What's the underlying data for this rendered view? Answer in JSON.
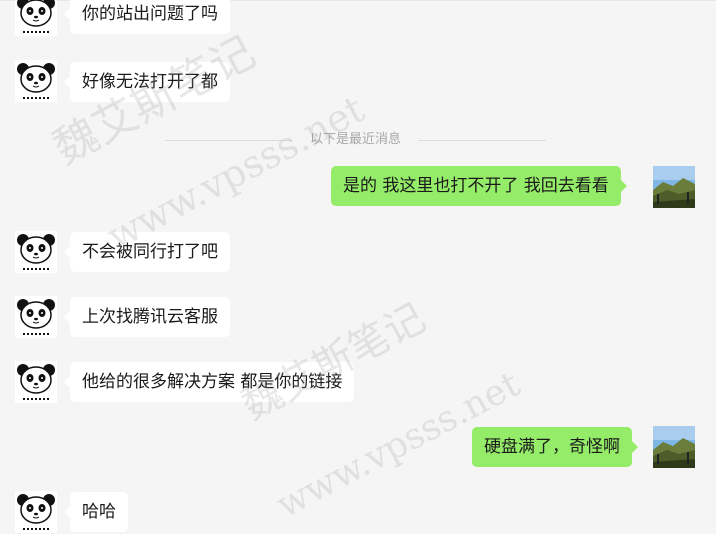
{
  "chat": {
    "divider_text": "以下是最近消息",
    "messages": [
      {
        "side": "in",
        "text": "你的站出问题了吗"
      },
      {
        "side": "in",
        "text": "好像无法打开了都"
      },
      {
        "side": "out",
        "text": "是的 我这里也打不开了 我回去看看"
      },
      {
        "side": "in",
        "text": "不会被同行打了吧"
      },
      {
        "side": "in",
        "text": "上次找腾讯云客服"
      },
      {
        "side": "in",
        "text": "他给的很多解决方案 都是你的链接"
      },
      {
        "side": "out",
        "text": "硬盘满了，奇怪啊"
      },
      {
        "side": "in",
        "text": "哈哈"
      }
    ]
  },
  "watermark": {
    "line1": "魏艾斯笔记",
    "line2": "www.vpsss.net"
  },
  "colors": {
    "background": "#f5f5f5",
    "incoming_bubble": "#ffffff",
    "outgoing_bubble": "#95ec69",
    "divider_text": "#a8a8a8"
  },
  "icons": {
    "incoming_avatar": "panda-avatar-icon",
    "outgoing_avatar": "landscape-avatar-icon"
  }
}
